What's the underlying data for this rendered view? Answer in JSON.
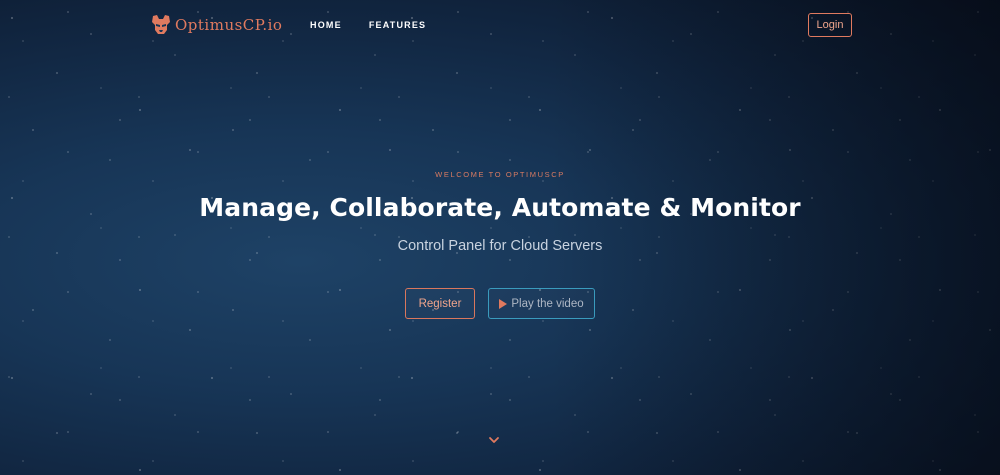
{
  "header": {
    "brand_text": "OptimusCP.io",
    "nav": [
      {
        "label": "HOME"
      },
      {
        "label": "FEATURES"
      }
    ],
    "login_label": "Login"
  },
  "hero": {
    "eyebrow": "WELCOME TO OPTIMUSCP",
    "headline": "Manage, Collaborate, Automate & Monitor",
    "subheadline": "Control Panel for Cloud Servers",
    "register_label": "Register",
    "video_label": "Play the video"
  },
  "icons": {
    "logo": "transformer-mask-icon",
    "play": "play-icon",
    "scroll": "chevron-down-icon"
  },
  "colors": {
    "accent": "#e07a5f",
    "secondary_border": "#3a9bbd",
    "background": "#173556"
  }
}
